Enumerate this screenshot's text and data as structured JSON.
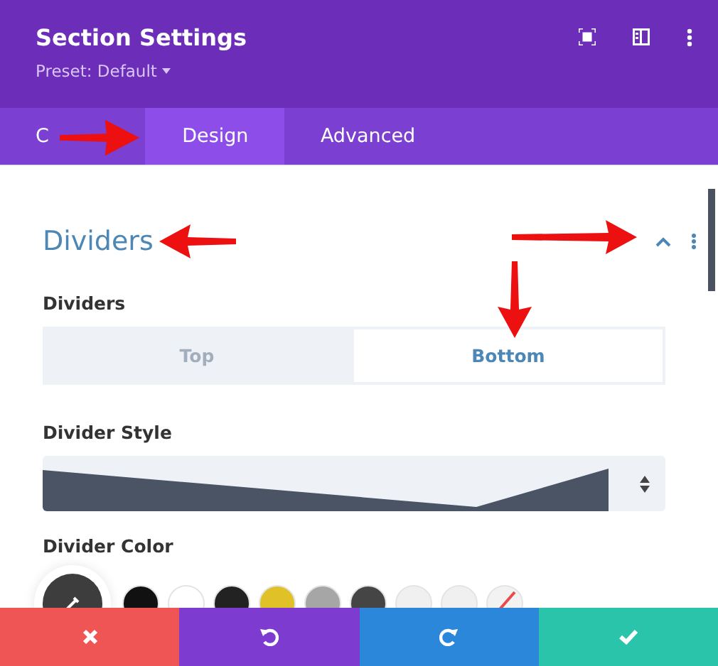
{
  "header": {
    "title": "Section Settings",
    "preset": "Preset: Default"
  },
  "tabs": [
    {
      "label": "C",
      "selected": false
    },
    {
      "label": "Design",
      "selected": true
    },
    {
      "label": "Advanced",
      "selected": false
    }
  ],
  "section": {
    "title": "Dividers",
    "expanded": true
  },
  "divider_position": {
    "label": "Dividers",
    "options": [
      {
        "label": "Top",
        "selected": false
      },
      {
        "label": "Bottom",
        "selected": true
      }
    ]
  },
  "divider_style": {
    "label": "Divider Style"
  },
  "divider_color": {
    "label": "Divider Color",
    "swatches": [
      {
        "color": "#111111"
      },
      {
        "color": "#ffffff"
      },
      {
        "color": "#222222"
      },
      {
        "color": "#e0c127"
      },
      {
        "color": "#a6a6a6"
      },
      {
        "color": "#454545"
      },
      {
        "color": "#f0f0f0"
      },
      {
        "color": "#f0f0f0"
      },
      {
        "kind": "none"
      }
    ]
  }
}
